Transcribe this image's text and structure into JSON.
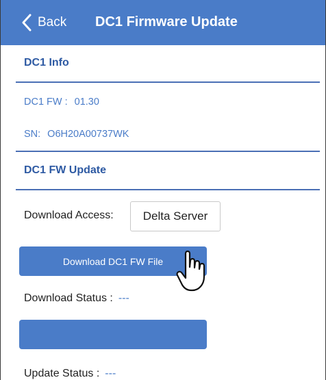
{
  "nav": {
    "back_label": "Back",
    "title": "DC1 Firmware Update"
  },
  "info": {
    "header": "DC1 Info",
    "fw_label": "DC1 FW :",
    "fw_value": "01.30",
    "sn_label": "SN:",
    "sn_value": "O6H20A00737WK"
  },
  "update": {
    "header": "DC1 FW Update",
    "access_label": "Download Access:",
    "access_value": "Delta Server",
    "download_button": "Download DC1 FW File",
    "download_status_label": "Download Status :",
    "download_status_value": "---",
    "update_button": "",
    "update_status_label": "Update Status :",
    "update_status_value": "---"
  },
  "colors": {
    "accent": "#4a7cc8",
    "header_text": "#2e5aa3"
  },
  "icons": {
    "back": "chevron-left-icon",
    "pointer": "hand-pointer-icon"
  }
}
